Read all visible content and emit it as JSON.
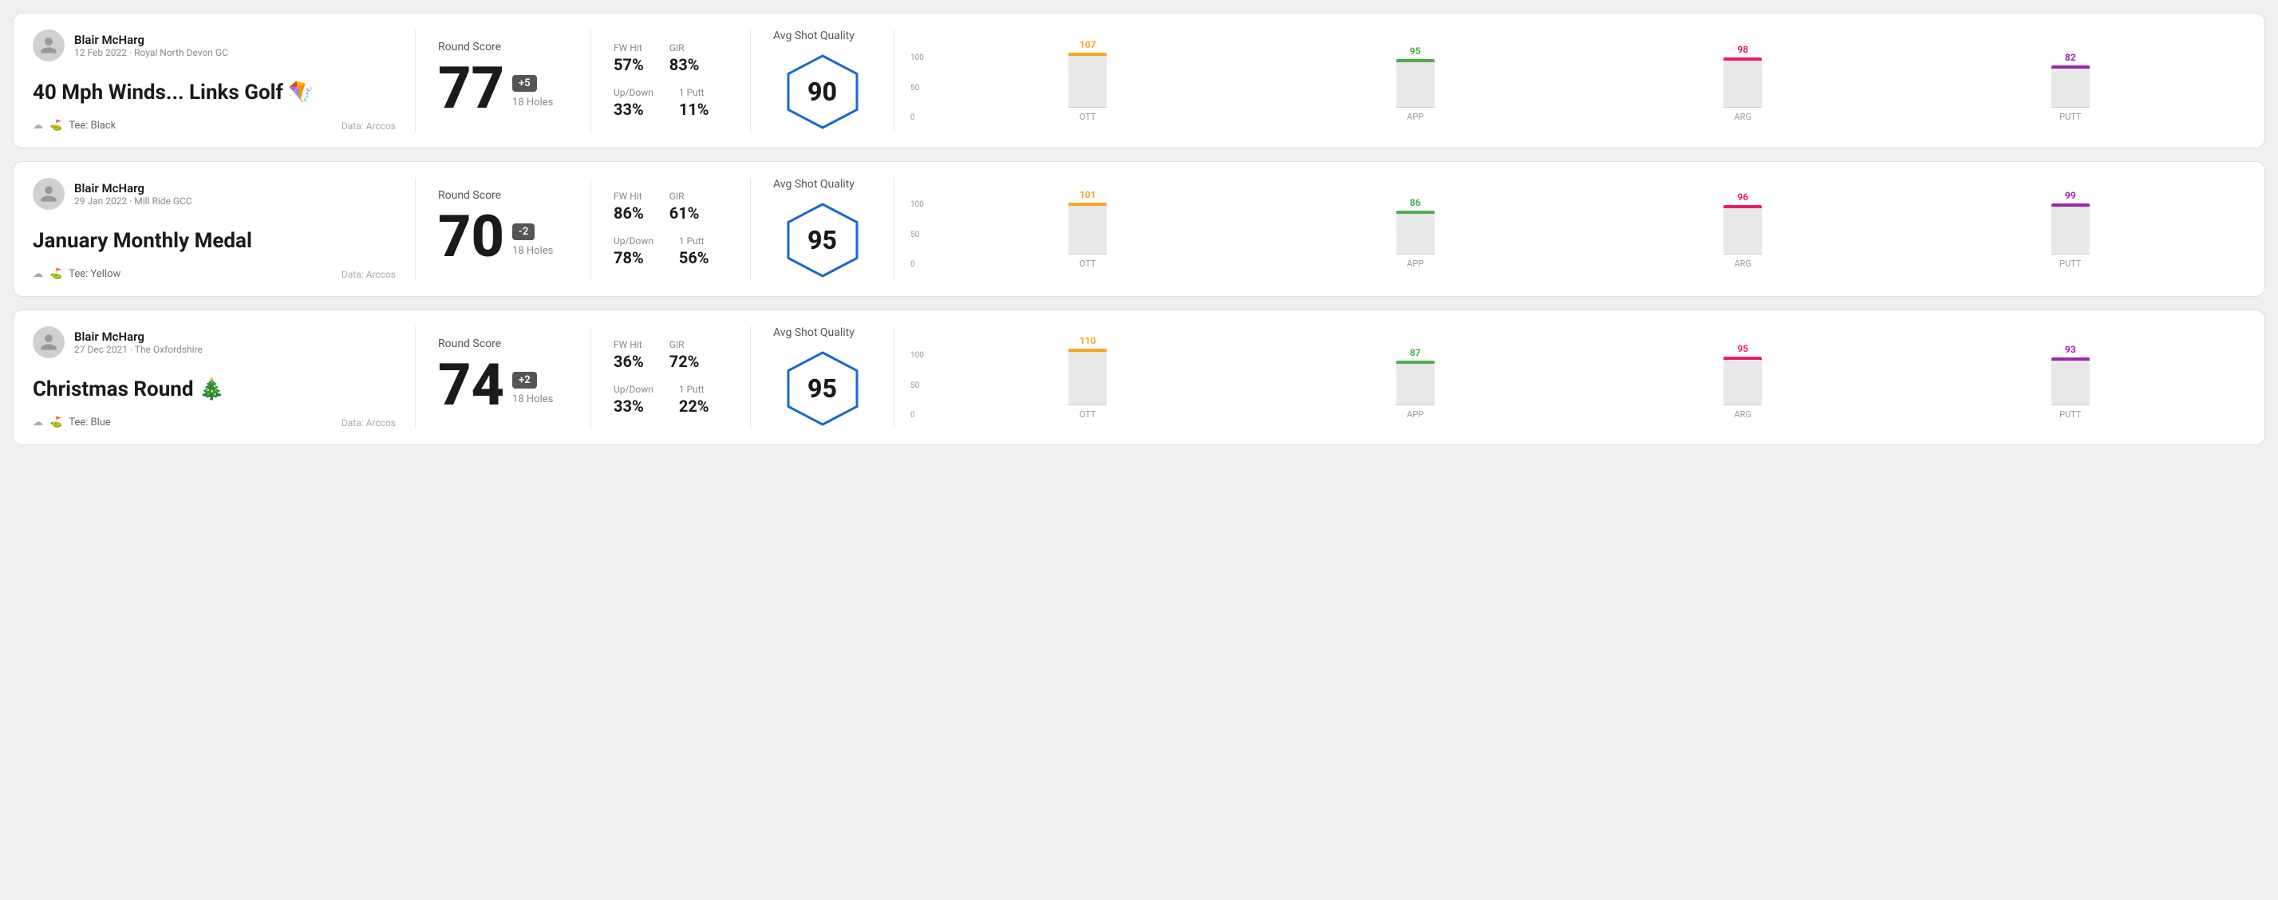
{
  "rounds": [
    {
      "id": "round1",
      "user": {
        "name": "Blair McHarg",
        "date": "12 Feb 2022 · Royal North Devon GC"
      },
      "title": "40 Mph Winds... Links Golf 🪁",
      "tee": "Black",
      "data_source": "Data: Arccos",
      "score": {
        "label": "Round Score",
        "value": "77",
        "badge": "+5",
        "holes": "18 Holes"
      },
      "stats": {
        "fw_hit_label": "FW Hit",
        "fw_hit_value": "57%",
        "gir_label": "GIR",
        "gir_value": "83%",
        "updown_label": "Up/Down",
        "updown_value": "33%",
        "oneputt_label": "1 Putt",
        "oneputt_value": "11%"
      },
      "quality": {
        "label": "Avg Shot Quality",
        "score": "90"
      },
      "chart": {
        "ott": {
          "value": 107,
          "height_pct": 85
        },
        "app": {
          "value": 95,
          "height_pct": 75
        },
        "arg": {
          "value": 98,
          "height_pct": 78
        },
        "putt": {
          "value": 82,
          "height_pct": 65
        }
      }
    },
    {
      "id": "round2",
      "user": {
        "name": "Blair McHarg",
        "date": "29 Jan 2022 · Mill Ride GCC"
      },
      "title": "January Monthly Medal",
      "tee": "Yellow",
      "data_source": "Data: Arccos",
      "score": {
        "label": "Round Score",
        "value": "70",
        "badge": "-2",
        "holes": "18 Holes"
      },
      "stats": {
        "fw_hit_label": "FW Hit",
        "fw_hit_value": "86%",
        "gir_label": "GIR",
        "gir_value": "61%",
        "updown_label": "Up/Down",
        "updown_value": "78%",
        "oneputt_label": "1 Putt",
        "oneputt_value": "56%"
      },
      "quality": {
        "label": "Avg Shot Quality",
        "score": "95"
      },
      "chart": {
        "ott": {
          "value": 101,
          "height_pct": 80
        },
        "app": {
          "value": 86,
          "height_pct": 68
        },
        "arg": {
          "value": 96,
          "height_pct": 76
        },
        "putt": {
          "value": 99,
          "height_pct": 79
        }
      }
    },
    {
      "id": "round3",
      "user": {
        "name": "Blair McHarg",
        "date": "27 Dec 2021 · The Oxfordshire"
      },
      "title": "Christmas Round 🎄",
      "tee": "Blue",
      "data_source": "Data: Arccos",
      "score": {
        "label": "Round Score",
        "value": "74",
        "badge": "+2",
        "holes": "18 Holes"
      },
      "stats": {
        "fw_hit_label": "FW Hit",
        "fw_hit_value": "36%",
        "gir_label": "GIR",
        "gir_value": "72%",
        "updown_label": "Up/Down",
        "updown_value": "33%",
        "oneputt_label": "1 Putt",
        "oneputt_value": "22%"
      },
      "quality": {
        "label": "Avg Shot Quality",
        "score": "95"
      },
      "chart": {
        "ott": {
          "value": 110,
          "height_pct": 88
        },
        "app": {
          "value": 87,
          "height_pct": 69
        },
        "arg": {
          "value": 95,
          "height_pct": 75
        },
        "putt": {
          "value": 93,
          "height_pct": 74
        }
      }
    }
  ],
  "chart_y_labels": [
    "100",
    "50",
    "0"
  ],
  "chart_x_labels": [
    "OTT",
    "APP",
    "ARG",
    "PUTT"
  ]
}
